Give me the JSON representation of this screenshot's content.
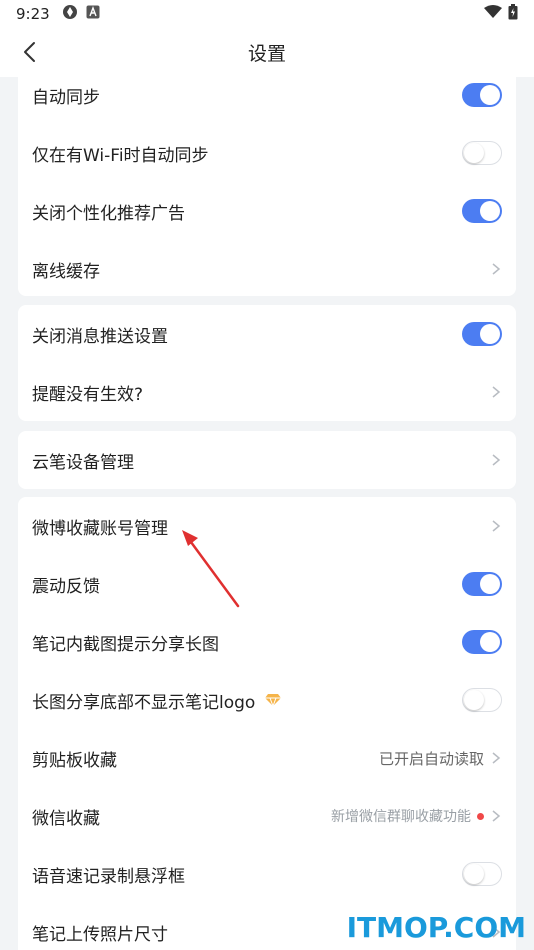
{
  "status_bar": {
    "time": "9:23",
    "icons": [
      "sync-icon",
      "app-a-icon",
      "wifi-icon",
      "battery-icon"
    ]
  },
  "header": {
    "title": "设置",
    "back_icon": "chevron-left-icon"
  },
  "colors": {
    "accent": "#4c7df2",
    "arrow": "#e03030",
    "watermark": "#1a9adb"
  },
  "cards": [
    {
      "rows": [
        {
          "label": "自动同步",
          "control": "toggle",
          "on": true
        },
        {
          "label": "仅在有Wi-Fi时自动同步",
          "control": "toggle",
          "on": false
        },
        {
          "label": "关闭个性化推荐广告",
          "control": "toggle",
          "on": true
        },
        {
          "label": "离线缓存",
          "control": "chevron"
        }
      ]
    },
    {
      "rows": [
        {
          "label": "关闭消息推送设置",
          "control": "toggle",
          "on": true
        },
        {
          "label": "提醒没有生效?",
          "control": "chevron"
        }
      ]
    },
    {
      "rows": [
        {
          "label": "云笔设备管理",
          "control": "chevron"
        }
      ]
    },
    {
      "rows": [
        {
          "label": "微博收藏账号管理",
          "control": "chevron"
        },
        {
          "label": "震动反馈",
          "control": "toggle",
          "on": true
        },
        {
          "label": "笔记内截图提示分享长图",
          "control": "toggle",
          "on": true
        },
        {
          "label": "长图分享底部不显示笔记logo",
          "control": "toggle",
          "on": false,
          "badge": "vip-diamond-icon"
        },
        {
          "label": "剪贴板收藏",
          "control": "chevron",
          "value": "已开启自动读取"
        },
        {
          "label": "微信收藏",
          "control": "chevron",
          "value": "新增微信群聊收藏功能",
          "dot": true
        },
        {
          "label": "语音速记录制悬浮框",
          "control": "toggle",
          "on": false
        },
        {
          "label": "笔记上传照片尺寸",
          "control": "chevron"
        }
      ]
    }
  ],
  "watermark": "ITMOP.COM"
}
